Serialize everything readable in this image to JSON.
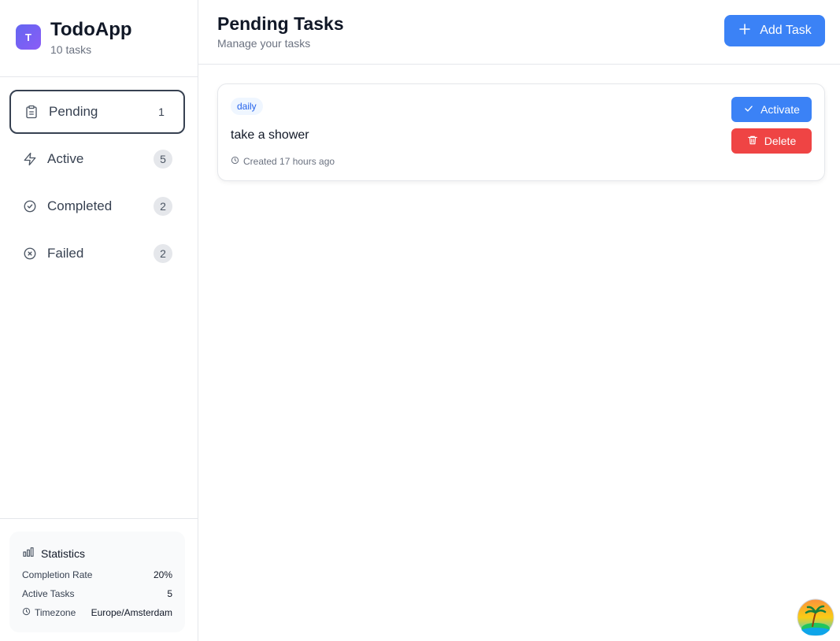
{
  "app": {
    "logo_letter": "T",
    "title": "TodoApp",
    "task_count": "10 tasks"
  },
  "nav": {
    "items": [
      {
        "label": "Pending",
        "count": "1",
        "icon": "clipboard-icon",
        "active": true
      },
      {
        "label": "Active",
        "count": "5",
        "icon": "lightning-icon"
      },
      {
        "label": "Completed",
        "count": "2",
        "icon": "check-circle-icon"
      },
      {
        "label": "Failed",
        "count": "2",
        "icon": "x-circle-icon"
      }
    ]
  },
  "stats": {
    "title": "Statistics",
    "completion_rate_label": "Completion Rate",
    "completion_rate_value": "20%",
    "active_tasks_label": "Active Tasks",
    "active_tasks_value": "5",
    "timezone_label": "Timezone",
    "timezone_value": "Europe/Amsterdam"
  },
  "header": {
    "title": "Pending Tasks",
    "subtitle": "Manage your tasks",
    "add_button_label": "Add Task"
  },
  "tasks": [
    {
      "tag": "daily",
      "title": "take a shower",
      "created": "Created 17 hours ago",
      "activate_label": "Activate",
      "delete_label": "Delete"
    }
  ],
  "colors": {
    "primary": "#3b82f6",
    "danger": "#ef4444",
    "logo_gradient_start": "#6366f1",
    "logo_gradient_end": "#8b5cf6"
  }
}
